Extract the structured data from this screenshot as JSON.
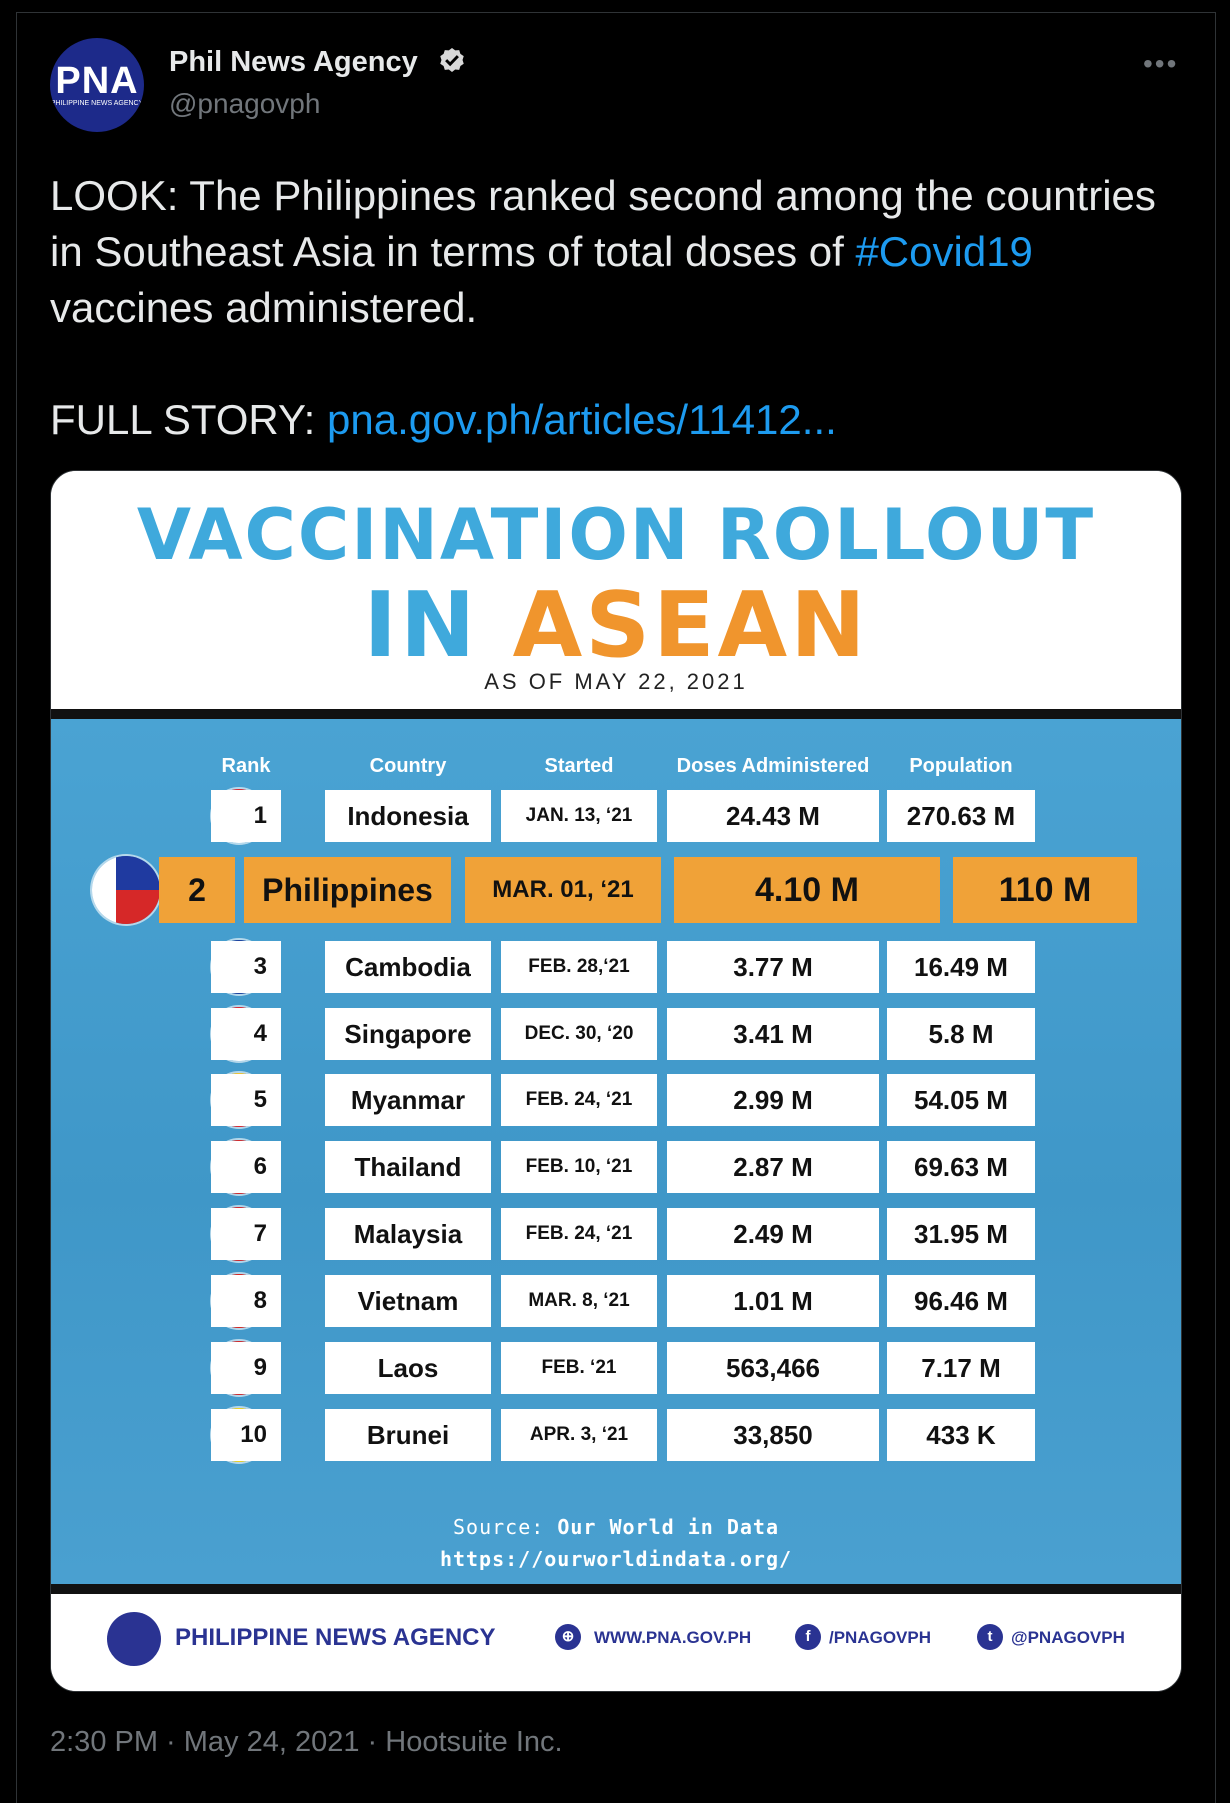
{
  "account": {
    "name": "Phil News Agency",
    "handle": "@pnagovph",
    "avatar_text": "PNA",
    "avatar_sub": "PHILIPPINE NEWS AGENCY"
  },
  "tweet": {
    "text_1": "LOOK: The Philippines ranked second among the countries in Southeast Asia in terms of total doses of ",
    "hashtag": "#Covid19",
    "text_2": " vaccines administered.",
    "story_label": "FULL STORY: ",
    "story_link": "pna.gov.ph/articles/11412..."
  },
  "infographic": {
    "title_line1": "VACCINATION ROLLOUT",
    "title_in": "IN",
    "title_asean": "ASEAN",
    "as_of": "AS OF MAY 22, 2021",
    "headers": {
      "rank": "Rank",
      "country": "Country",
      "started": "Started",
      "doses": "Doses Administered",
      "population": "Population"
    },
    "rows": [
      {
        "rank": "1",
        "country": "Indonesia",
        "started": "JAN. 13, ‘21",
        "doses": "24.43 M",
        "population": "270.63 M"
      },
      {
        "rank": "2",
        "country": "Philippines",
        "started": "MAR. 01, ‘21",
        "doses": "4.10 M",
        "population": "110 M"
      },
      {
        "rank": "3",
        "country": "Cambodia",
        "started": "FEB. 28,‘21",
        "doses": "3.77 M",
        "population": "16.49 M"
      },
      {
        "rank": "4",
        "country": "Singapore",
        "started": "DEC. 30, ‘20",
        "doses": "3.41 M",
        "population": "5.8 M"
      },
      {
        "rank": "5",
        "country": "Myanmar",
        "started": "FEB. 24, ‘21",
        "doses": "2.99 M",
        "population": "54.05 M"
      },
      {
        "rank": "6",
        "country": "Thailand",
        "started": "FEB. 10, ‘21",
        "doses": "2.87 M",
        "population": "69.63 M"
      },
      {
        "rank": "7",
        "country": "Malaysia",
        "started": "FEB. 24, ‘21",
        "doses": "2.49 M",
        "population": "31.95 M"
      },
      {
        "rank": "8",
        "country": "Vietnam",
        "started": "MAR. 8, ‘21",
        "doses": "1.01 M",
        "population": "96.46 M"
      },
      {
        "rank": "9",
        "country": "Laos",
        "started": "FEB. ‘21",
        "doses": "563,466",
        "population": "7.17 M"
      },
      {
        "rank": "10",
        "country": "Brunei",
        "started": "APR. 3, ‘21",
        "doses": "33,850",
        "population": "433 K"
      }
    ],
    "source_label": "Source: ",
    "source_name": "Our World in Data",
    "source_url": "https://ourworldindata.org/",
    "footer": {
      "agency": "PHILIPPINE NEWS AGENCY",
      "website": "WWW.PNA.GOV.PH",
      "facebook": "/PNAGOVPH",
      "twitter": "@PNAGOVPH"
    }
  },
  "timestamp": "2:30 PM · May 24, 2021 · Hootsuite Inc.",
  "colors": {
    "link": "#1d9bf0",
    "title_blue": "#3fa9dc",
    "title_orange": "#f0952d",
    "highlight": "#f0a238"
  }
}
